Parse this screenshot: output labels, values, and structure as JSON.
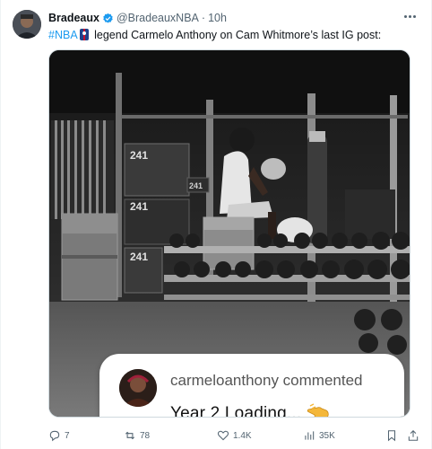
{
  "author": {
    "display_name": "Bradeaux",
    "handle": "@BradeauxNBA",
    "separator": "·",
    "time": "10h",
    "verified_color": "#1d9bf0"
  },
  "tweet": {
    "hashtag": "#NBA",
    "text": " legend Carmelo Anthony on Cam Whitmore’s last IG post:",
    "hashtag_color": "#1d9bf0"
  },
  "media": {
    "photo_labels": [
      "241",
      "241",
      "241",
      "241"
    ],
    "comment": {
      "username_line": "carmeloanthony commented",
      "text": "Year 2 Loading..."
    }
  },
  "actions": {
    "replies": "7",
    "reposts": "78",
    "likes": "1.4K",
    "views": "35K"
  },
  "icons": [
    "verified-badge-icon",
    "basketball-icon",
    "more-icon",
    "reply-icon",
    "repost-icon",
    "like-icon",
    "views-icon",
    "bookmark-icon",
    "share-icon",
    "pointing-hand-emoji"
  ]
}
